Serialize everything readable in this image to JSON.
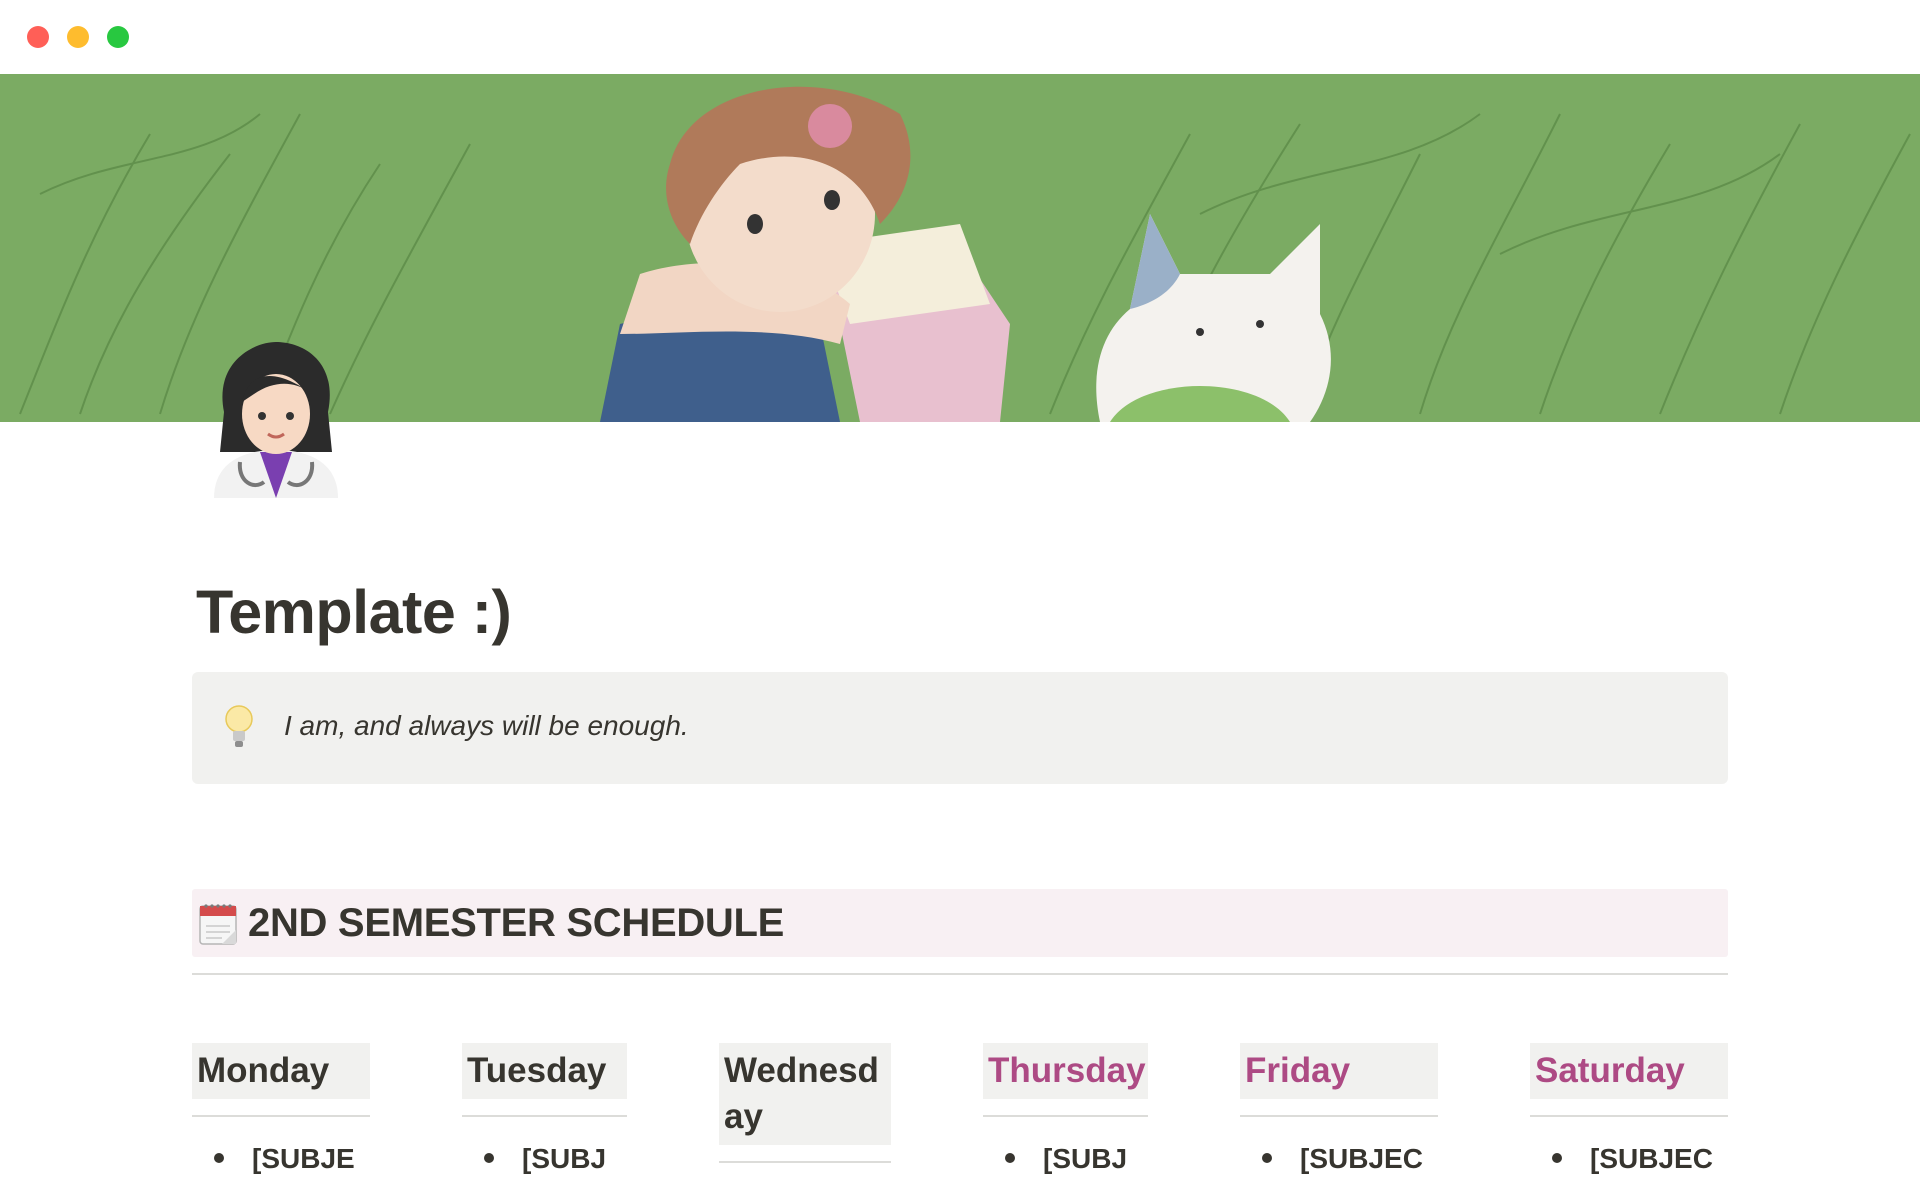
{
  "window": {
    "controls": [
      "close",
      "minimize",
      "maximize"
    ]
  },
  "cover": {
    "image": "illustration of girl and cat sitting in green grass",
    "colors": {
      "grass": "#7bab63",
      "grass_dark": "#5f9449"
    }
  },
  "page": {
    "icon": "woman-health-worker-icon",
    "title": "Template :)"
  },
  "callout": {
    "icon": "lightbulb-icon",
    "text": "I am, and always will be enough."
  },
  "schedule": {
    "icon": "calendar-icon",
    "heading": "2ND SEMESTER SCHEDULE",
    "accent": "#ad4a84",
    "days": [
      {
        "label": "Monday",
        "item": "[SUBJE"
      },
      {
        "label": "Tuesday",
        "item": "[SUBJ"
      },
      {
        "label": "Wednesd ay",
        "label_lines": [
          "Wednesd",
          "ay"
        ],
        "item": ""
      },
      {
        "label": "Thursday",
        "item": "[SUBJ"
      },
      {
        "label": "Friday",
        "item": "[SUBJEC"
      },
      {
        "label": "Saturday",
        "item": "[SUBJEC"
      }
    ]
  }
}
